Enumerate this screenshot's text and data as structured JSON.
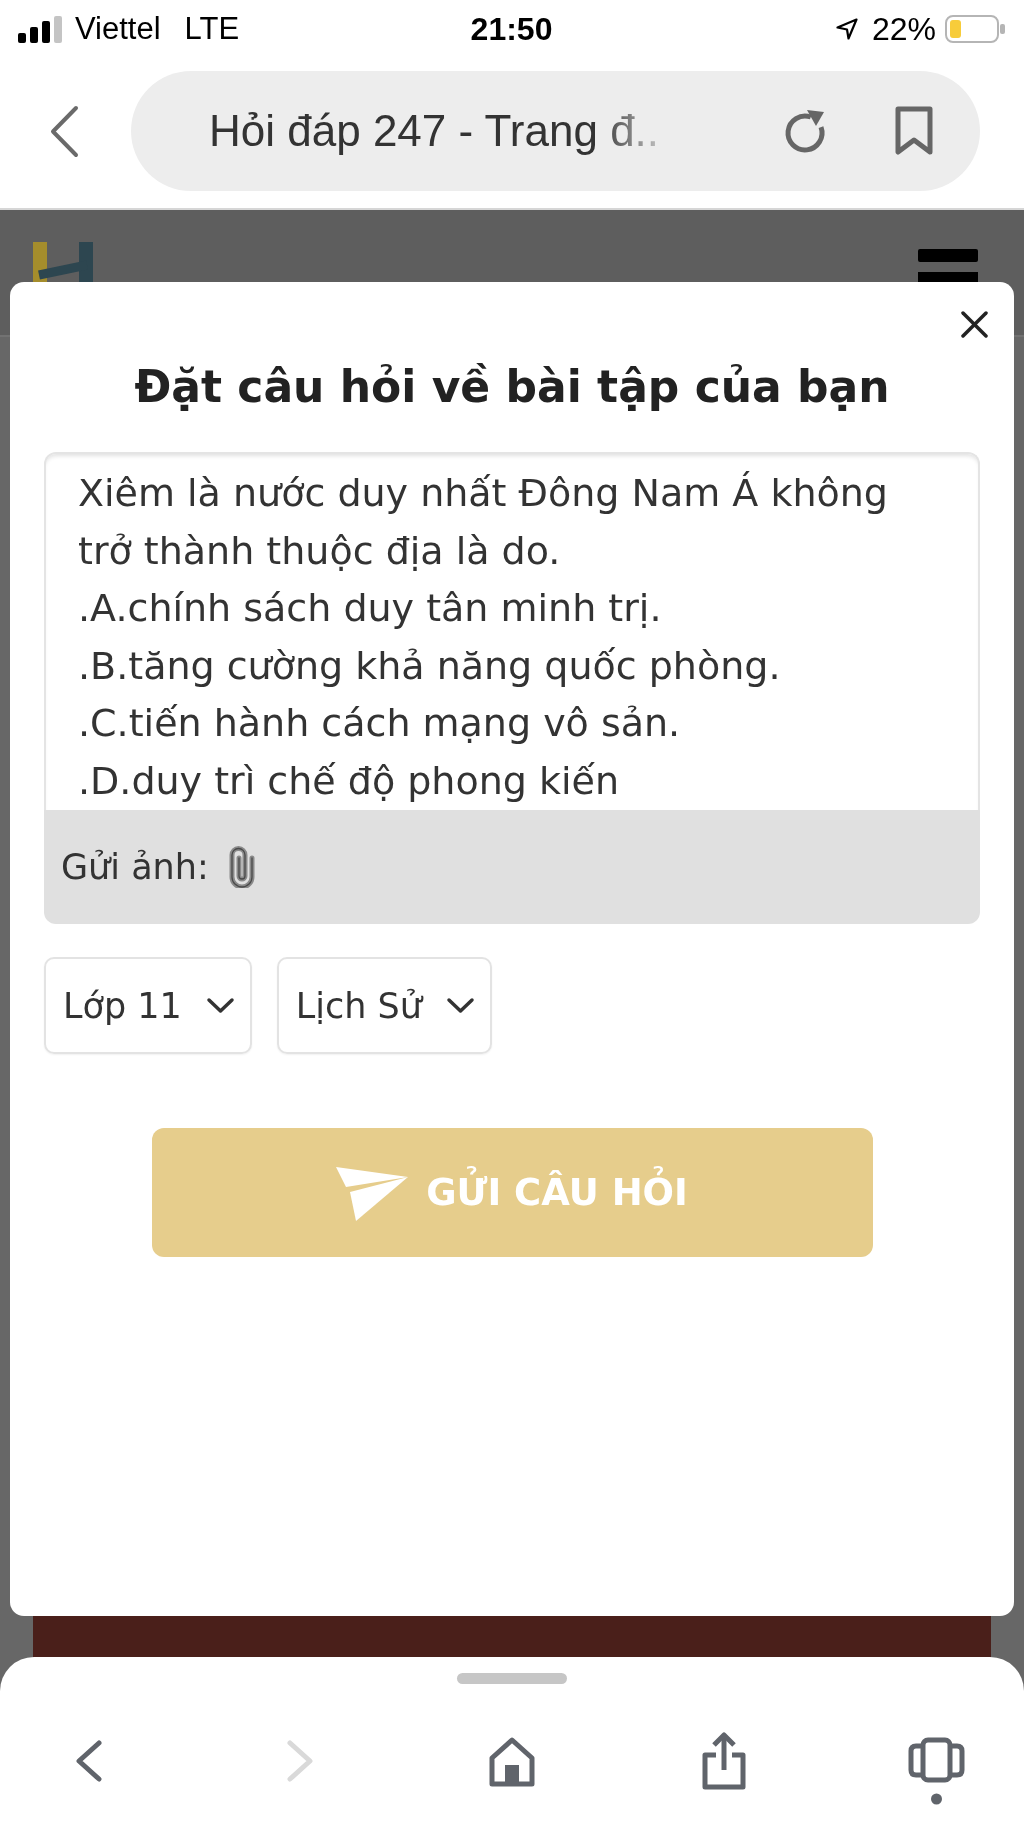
{
  "status_bar": {
    "carrier": "Viettel",
    "network": "LTE",
    "time": "21:50",
    "battery": "22%"
  },
  "address_bar": {
    "page_title": "Hỏi đáp 247 - Trang đ.."
  },
  "modal": {
    "title": "Đặt câu hỏi về bài tập của bạn",
    "question": {
      "value": "Xiêm là nước duy nhất Đông Nam Á không trở thành thuộc địa là do.\n.A.chính sách duy tân minh trị.\n.B.tăng cường khả năng quốc phòng.\n.C.tiến hành cách mạng vô sản.\n.D.duy trì chế độ phong kiến"
    },
    "attach_label": "Gửi ảnh:",
    "selects": [
      {
        "value": "Lớp 11"
      },
      {
        "value": "Lịch Sử"
      }
    ],
    "submit_button": {
      "label": "GỬI CÂU HỎI"
    }
  },
  "toolbar": {
    "buttons": [
      {
        "kind": "back",
        "disabled": false
      },
      {
        "kind": "forward",
        "disabled": true
      },
      {
        "kind": "home",
        "disabled": false
      },
      {
        "kind": "share",
        "disabled": false
      },
      {
        "kind": "tabs",
        "disabled": false
      }
    ]
  }
}
